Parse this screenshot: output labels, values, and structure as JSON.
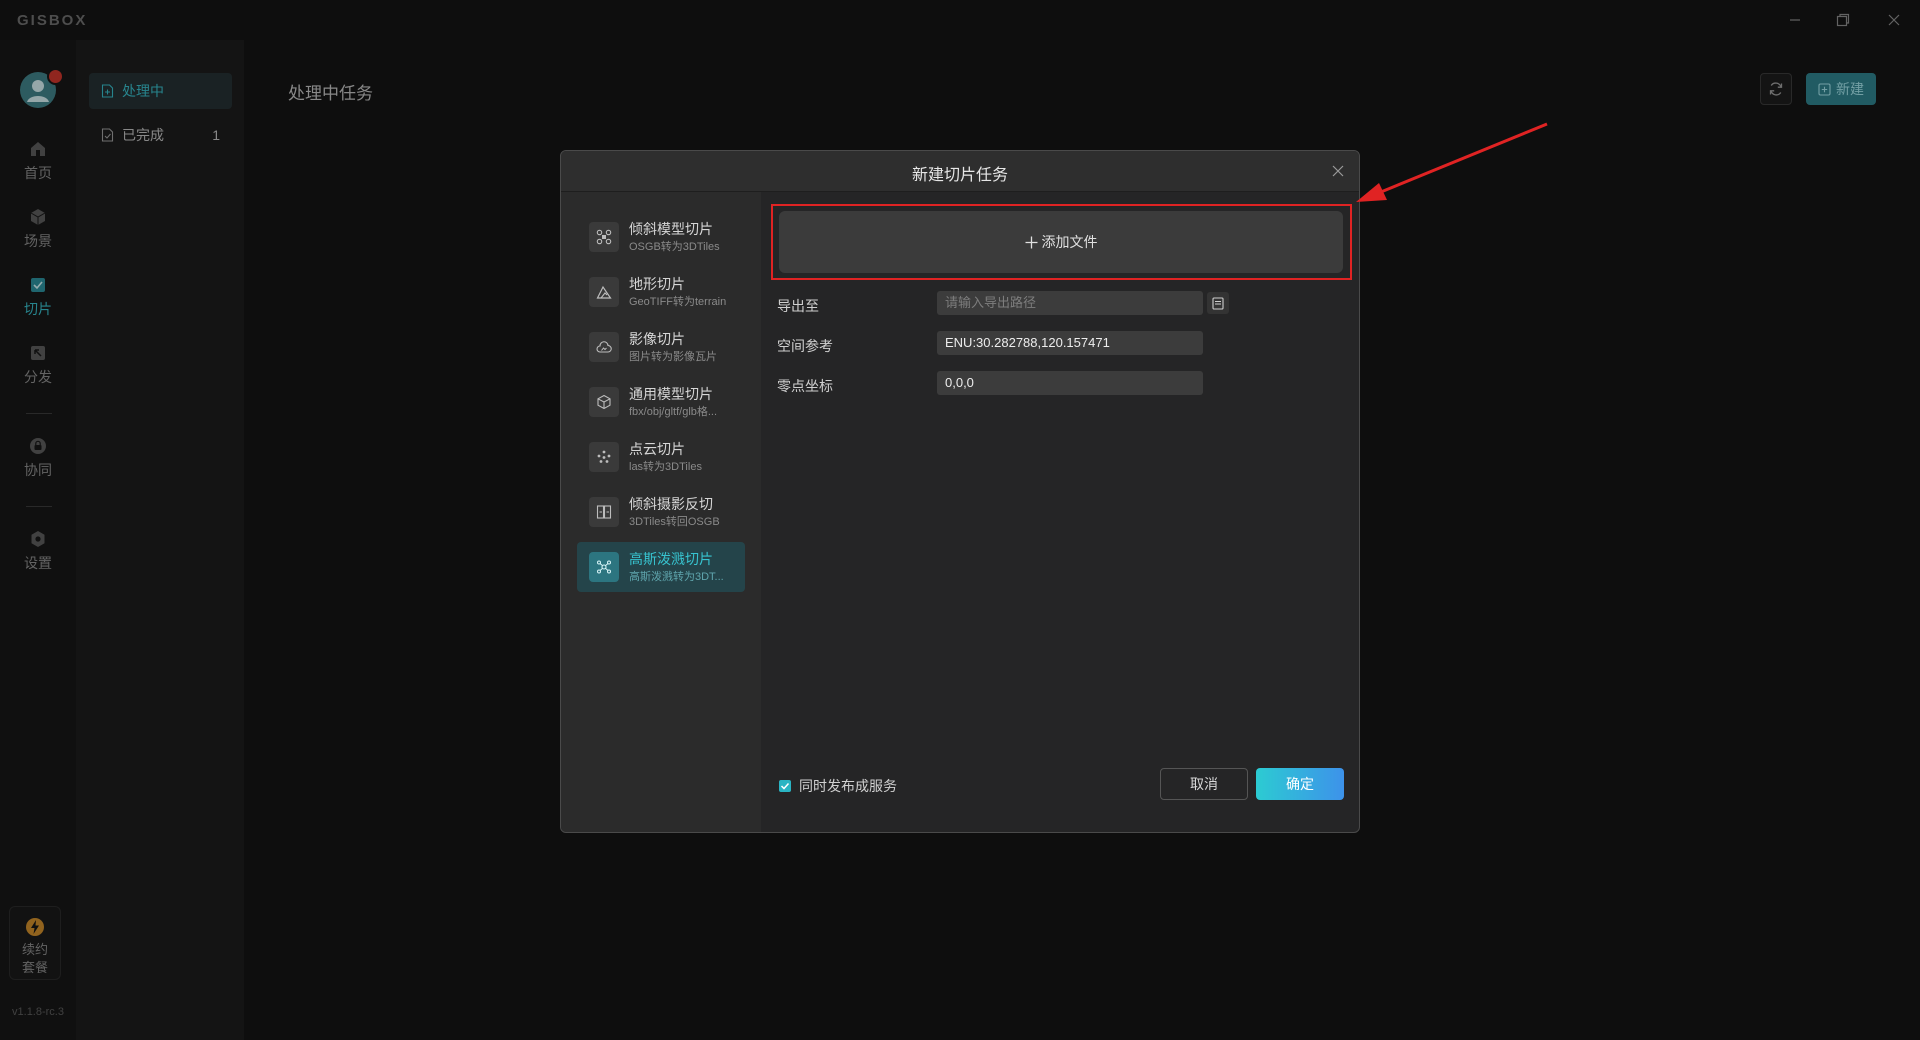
{
  "app": {
    "logo": "GISBOX",
    "version": "v1.1.8-rc.3"
  },
  "window_controls": [
    "minimize",
    "restore",
    "close"
  ],
  "rail": {
    "items": [
      {
        "label": "首页",
        "icon": "home-icon"
      },
      {
        "label": "场景",
        "icon": "cube-icon"
      },
      {
        "label": "切片",
        "icon": "slice-icon",
        "active": true
      },
      {
        "label": "分发",
        "icon": "distribute-icon"
      },
      {
        "label": "协同",
        "icon": "lock-icon"
      },
      {
        "label": "设置",
        "icon": "gear-icon"
      }
    ],
    "plan": {
      "label": "续约套餐",
      "icon": "lightning-icon"
    }
  },
  "subnav": {
    "items": [
      {
        "label": "处理中",
        "active": true
      },
      {
        "label": "已完成",
        "count": "1"
      }
    ]
  },
  "main": {
    "title": "处理中任务",
    "new_label": "新建"
  },
  "dialog": {
    "title": "新建切片任务",
    "types": [
      {
        "name": "倾斜模型切片",
        "desc": "OSGB转为3DTiles",
        "icon": "drone-icon"
      },
      {
        "name": "地形切片",
        "desc": "GeoTIFF转为terrain",
        "icon": "mountain-icon"
      },
      {
        "name": "影像切片",
        "desc": "图片转为影像瓦片",
        "icon": "cloud-image-icon"
      },
      {
        "name": "通用模型切片",
        "desc": "fbx/obj/gltf/glb格...",
        "icon": "box-icon"
      },
      {
        "name": "点云切片",
        "desc": "las转为3DTiles",
        "icon": "pointcloud-icon"
      },
      {
        "name": "倾斜摄影反切",
        "desc": "3DTiles转回OSGB",
        "icon": "reverse-icon"
      },
      {
        "name": "高斯泼溅切片",
        "desc": "高斯泼溅转为3DT...",
        "icon": "gaussian-icon",
        "active": true
      }
    ],
    "add_file": "添加文件",
    "fields": {
      "export_label": "导出至",
      "export_placeholder": "请输入导出路径",
      "spatial_label": "空间参考",
      "spatial_value": "ENU:30.282788,120.157471",
      "origin_label": "零点坐标",
      "origin_value": "0,0,0"
    },
    "publish_label": "同时发布成服务",
    "publish_checked": true,
    "cancel": "取消",
    "ok": "确定"
  },
  "colors": {
    "accent": "#37b8c4",
    "highlight": "#e02323",
    "arrow": "#e02323"
  }
}
